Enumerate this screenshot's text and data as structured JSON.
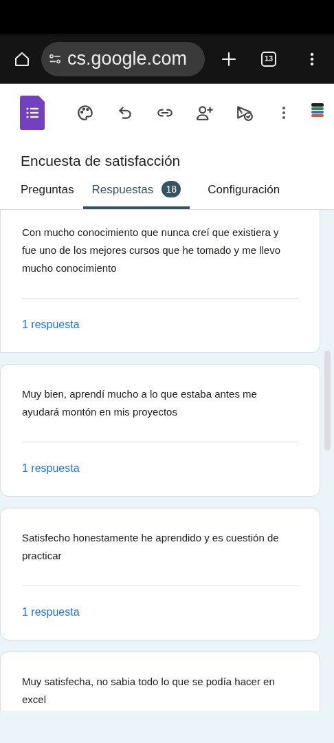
{
  "browser": {
    "url": "cs.google.com",
    "tab_count": "13"
  },
  "form": {
    "title": "Encuesta de satisfacción"
  },
  "tabs": [
    {
      "label": "Preguntas",
      "selected": false
    },
    {
      "label": "Respuestas",
      "selected": true,
      "badge": "18"
    },
    {
      "label": "Configuración",
      "selected": false
    }
  ],
  "responses": [
    {
      "text": "Con mucho conocimiento que nunca creí que existiera y fue uno de los mejores cursos que he tomado y me llevo mucho conocimiento",
      "count": "1 respuesta"
    },
    {
      "text": "Muy bien, aprendí mucho a lo que estaba antes me ayudará montón en mis proyectos",
      "count": "1 respuesta"
    },
    {
      "text": "Satisfecho honestamente he aprendido y es cuestión de practicar",
      "count": "1 respuesta"
    },
    {
      "text": "Muy satisfecha, no sabia todo lo que se podía hacer en excel"
    }
  ]
}
